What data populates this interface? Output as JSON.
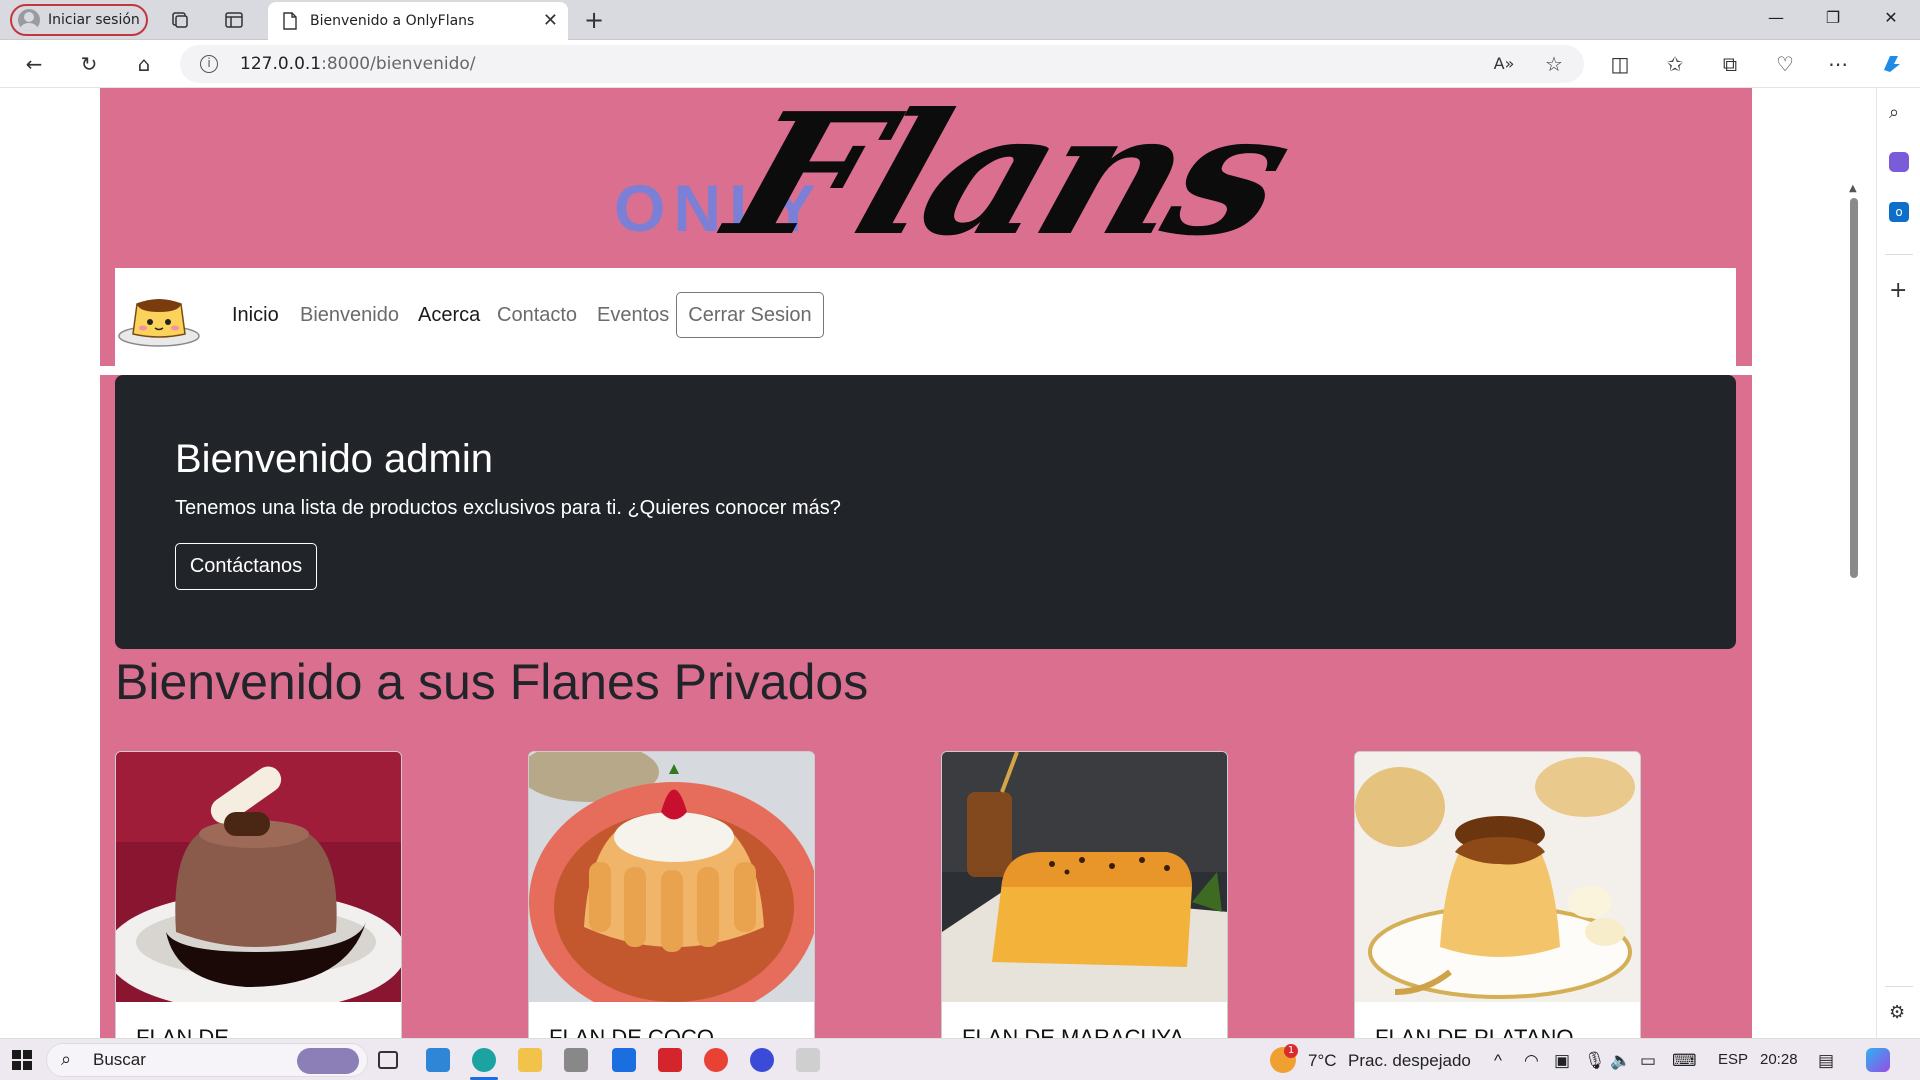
{
  "browser": {
    "profile_label": "Iniciar sesión",
    "tab_title": "Bienvenido a OnlyFlans",
    "url_host": "127.0.0.1",
    "url_rest": ":8000/bienvenido/"
  },
  "logo": {
    "only": "ONLY",
    "flans": "Flans"
  },
  "nav": {
    "links": [
      "Inicio",
      "Bienvenido",
      "Acerca",
      "Contacto",
      "Eventos"
    ],
    "logout_label": "Cerrar Sesion"
  },
  "hero": {
    "title": "Bienvenido admin",
    "subtitle": "Tenemos una lista de productos exclusivos para ti. ¿Quieres conocer más?",
    "button_label": "Contáctanos"
  },
  "section_title": "Bienvenido a sus Flanes Privados",
  "cards": [
    {
      "title": "FLAN DE",
      "image": "chocolate-flan-image"
    },
    {
      "title": "FLAN DE COCO",
      "image": "coconut-flan-image"
    },
    {
      "title": "FLAN DE MARACUYA",
      "image": "passionfruit-flan-image"
    },
    {
      "title": "FLAN DE PLATANO",
      "image": "banana-flan-image"
    }
  ],
  "taskbar": {
    "search_placeholder": "Buscar",
    "weather_temp": "7°C",
    "weather_desc": "Prac. despejado",
    "weather_badge": "1",
    "language": "ESP",
    "time": "20:28"
  },
  "colors": {
    "page_bg": "#db6f8f",
    "hero_bg": "#212429",
    "logo_only": "#7b7fd6",
    "profile_border": "#c2373f"
  }
}
